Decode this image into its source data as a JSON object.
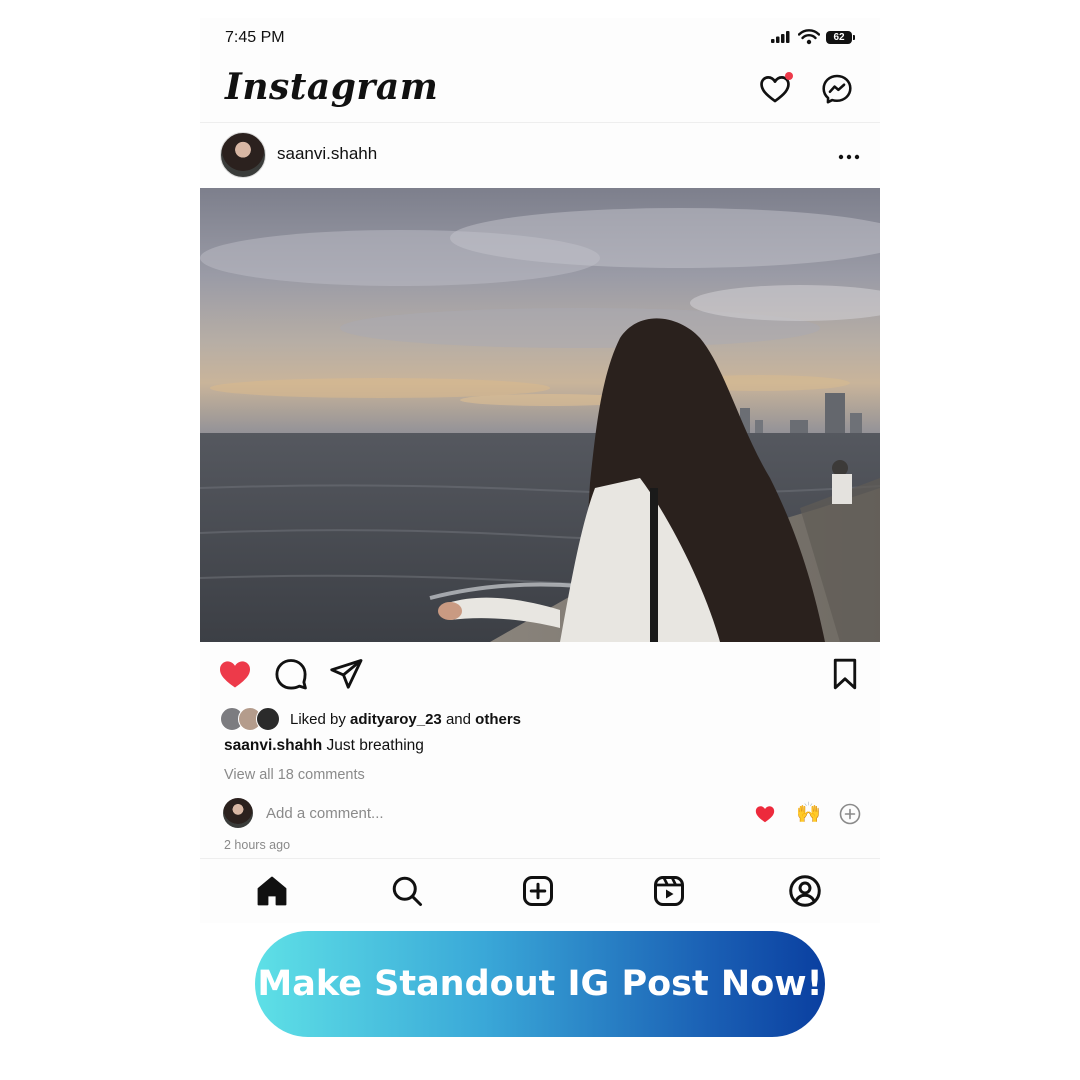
{
  "status_bar": {
    "time": "7:45 PM",
    "battery": "62"
  },
  "app": {
    "brand": "Instagram"
  },
  "post": {
    "username": "saanvi.shahh",
    "liked_prefix": "Liked by",
    "liked_user": "adityaroy_23",
    "liked_and": "and",
    "liked_others": "others",
    "caption_user": "saanvi.shahh",
    "caption_text": "Just breathing",
    "view_comments": "View all 18 comments",
    "timestamp": "2 hours ago"
  },
  "comment": {
    "placeholder": "Add a comment...",
    "quick_reactions": [
      "❤️",
      "🙌"
    ]
  },
  "cta": {
    "label": "Make Standout IG Post Now!"
  },
  "colors": {
    "like_red": "#ed3a4a",
    "cta_start": "#5ee0e6",
    "cta_end": "#0a3fa0"
  },
  "icons": {
    "header": [
      "heart-icon",
      "messenger-icon"
    ],
    "actions": [
      "heart-filled-icon",
      "comment-icon",
      "share-icon",
      "bookmark-icon"
    ],
    "nav": [
      "home-icon",
      "search-icon",
      "create-icon",
      "reels-icon",
      "profile-icon"
    ]
  }
}
